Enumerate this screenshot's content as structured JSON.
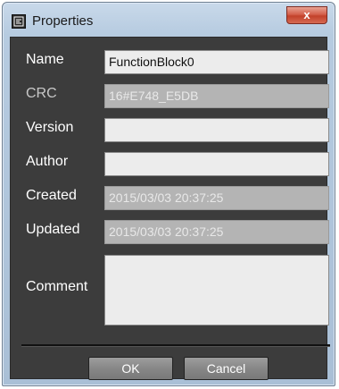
{
  "window": {
    "title": "Properties",
    "close_label": "x"
  },
  "fields": {
    "name": {
      "label": "Name",
      "value": "FunctionBlock0"
    },
    "crc": {
      "label": "CRC",
      "value": "16#E748_E5DB"
    },
    "version": {
      "label": "Version",
      "value": ""
    },
    "author": {
      "label": "Author",
      "value": ""
    },
    "created": {
      "label": "Created",
      "value": "2015/03/03 20:37:25"
    },
    "updated": {
      "label": "Updated",
      "value": "2015/03/03 20:37:25"
    },
    "comment": {
      "label": "Comment",
      "value": ""
    }
  },
  "buttons": {
    "ok": "OK",
    "cancel": "Cancel"
  },
  "colors": {
    "panel_bg": "#3c3c3c",
    "editable_field": "#ececec",
    "readonly_field": "#b4b4b4",
    "close_button": "#c94a35"
  },
  "icons": {
    "app": "properties-window-icon",
    "close": "close-icon"
  }
}
